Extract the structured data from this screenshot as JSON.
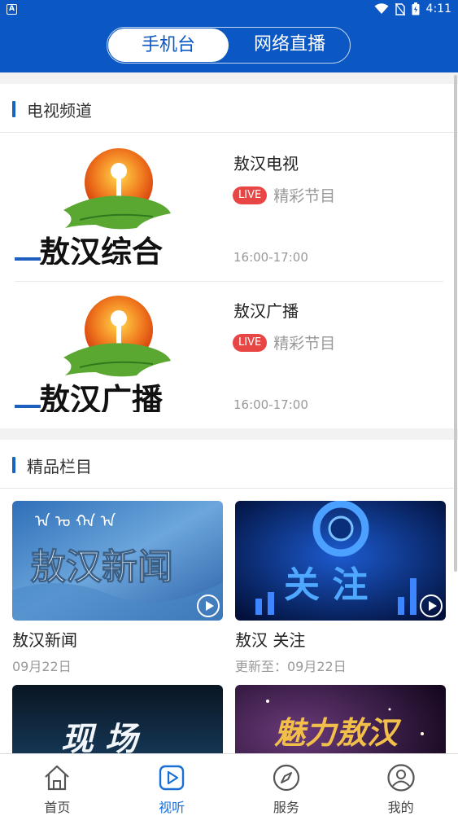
{
  "status": {
    "time": "4:11",
    "app_icon_letter": "A"
  },
  "header": {
    "tabs": [
      {
        "label": "手机台",
        "active": true
      },
      {
        "label": "网络直播",
        "active": false
      }
    ],
    "color": "#0b57c3"
  },
  "tv_section": {
    "title": "电视频道",
    "channels": [
      {
        "name": "敖汉电视",
        "live_badge": "LIVE",
        "program": "精彩节目",
        "time": "16:00-17:00",
        "logo_text": "敖汉综合"
      },
      {
        "name": "敖汉广播",
        "live_badge": "LIVE",
        "program": "精彩节目",
        "time": "16:00-17:00",
        "logo_text": "敖汉广播"
      }
    ]
  },
  "featured_section": {
    "title": "精品栏目",
    "items": [
      {
        "name": "敖汉新闻",
        "date": "09月22日",
        "thumb_text": "敖汉新闻"
      },
      {
        "name": "敖汉 关注",
        "date": "更新至：09月22日",
        "thumb_text": "关 注"
      },
      {
        "name": "",
        "date": "",
        "thumb_text": "现 场"
      },
      {
        "name": "",
        "date": "",
        "thumb_text": "魅力敖汉"
      }
    ]
  },
  "bottom_nav": {
    "items": [
      {
        "label": "首页",
        "icon": "home-icon",
        "active": false
      },
      {
        "label": "视听",
        "icon": "play-icon",
        "active": true
      },
      {
        "label": "服务",
        "icon": "compass-icon",
        "active": false
      },
      {
        "label": "我的",
        "icon": "user-icon",
        "active": false
      }
    ]
  },
  "colors": {
    "accent": "#1a6fd6",
    "live": "#e84545",
    "header": "#0b57c3"
  }
}
